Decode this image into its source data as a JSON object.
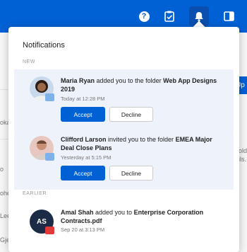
{
  "topbar": {
    "help_icon": "help-icon",
    "help_glyph": "?",
    "tasks_icon": "tasks-icon",
    "bell_icon": "bell-icon",
    "panel_icon": "panel-icon",
    "accent": "#0061d5"
  },
  "background": {
    "upload_label": "Up",
    "row_labels": [
      "oka",
      "o",
      "ohe",
      "Lee",
      "Gje"
    ],
    "right_text": [
      "older",
      "ils."
    ]
  },
  "notifications": {
    "title": "Notifications",
    "section_new": "NEW",
    "section_earlier": "EARLIER",
    "items": [
      {
        "actor": "Maria Ryan",
        "action": " added you to the folder ",
        "target": "Web App Designs 2019",
        "time": "Today at 12:28 PM",
        "accept": "Accept",
        "decline": "Decline"
      },
      {
        "actor": "Clifford Larson",
        "action": " invited you to the folder ",
        "target": "EMEA Major Deal Close Plans",
        "time": "Yesterday at 5:15 PM",
        "accept": "Accept",
        "decline": "Decline"
      },
      {
        "actor": "Amal Shah",
        "action": " added you to ",
        "target": "Enterprise Corporation Contracts.pdf",
        "time": "Sep 20 at 3:13 PM",
        "initials": "AS"
      }
    ]
  }
}
